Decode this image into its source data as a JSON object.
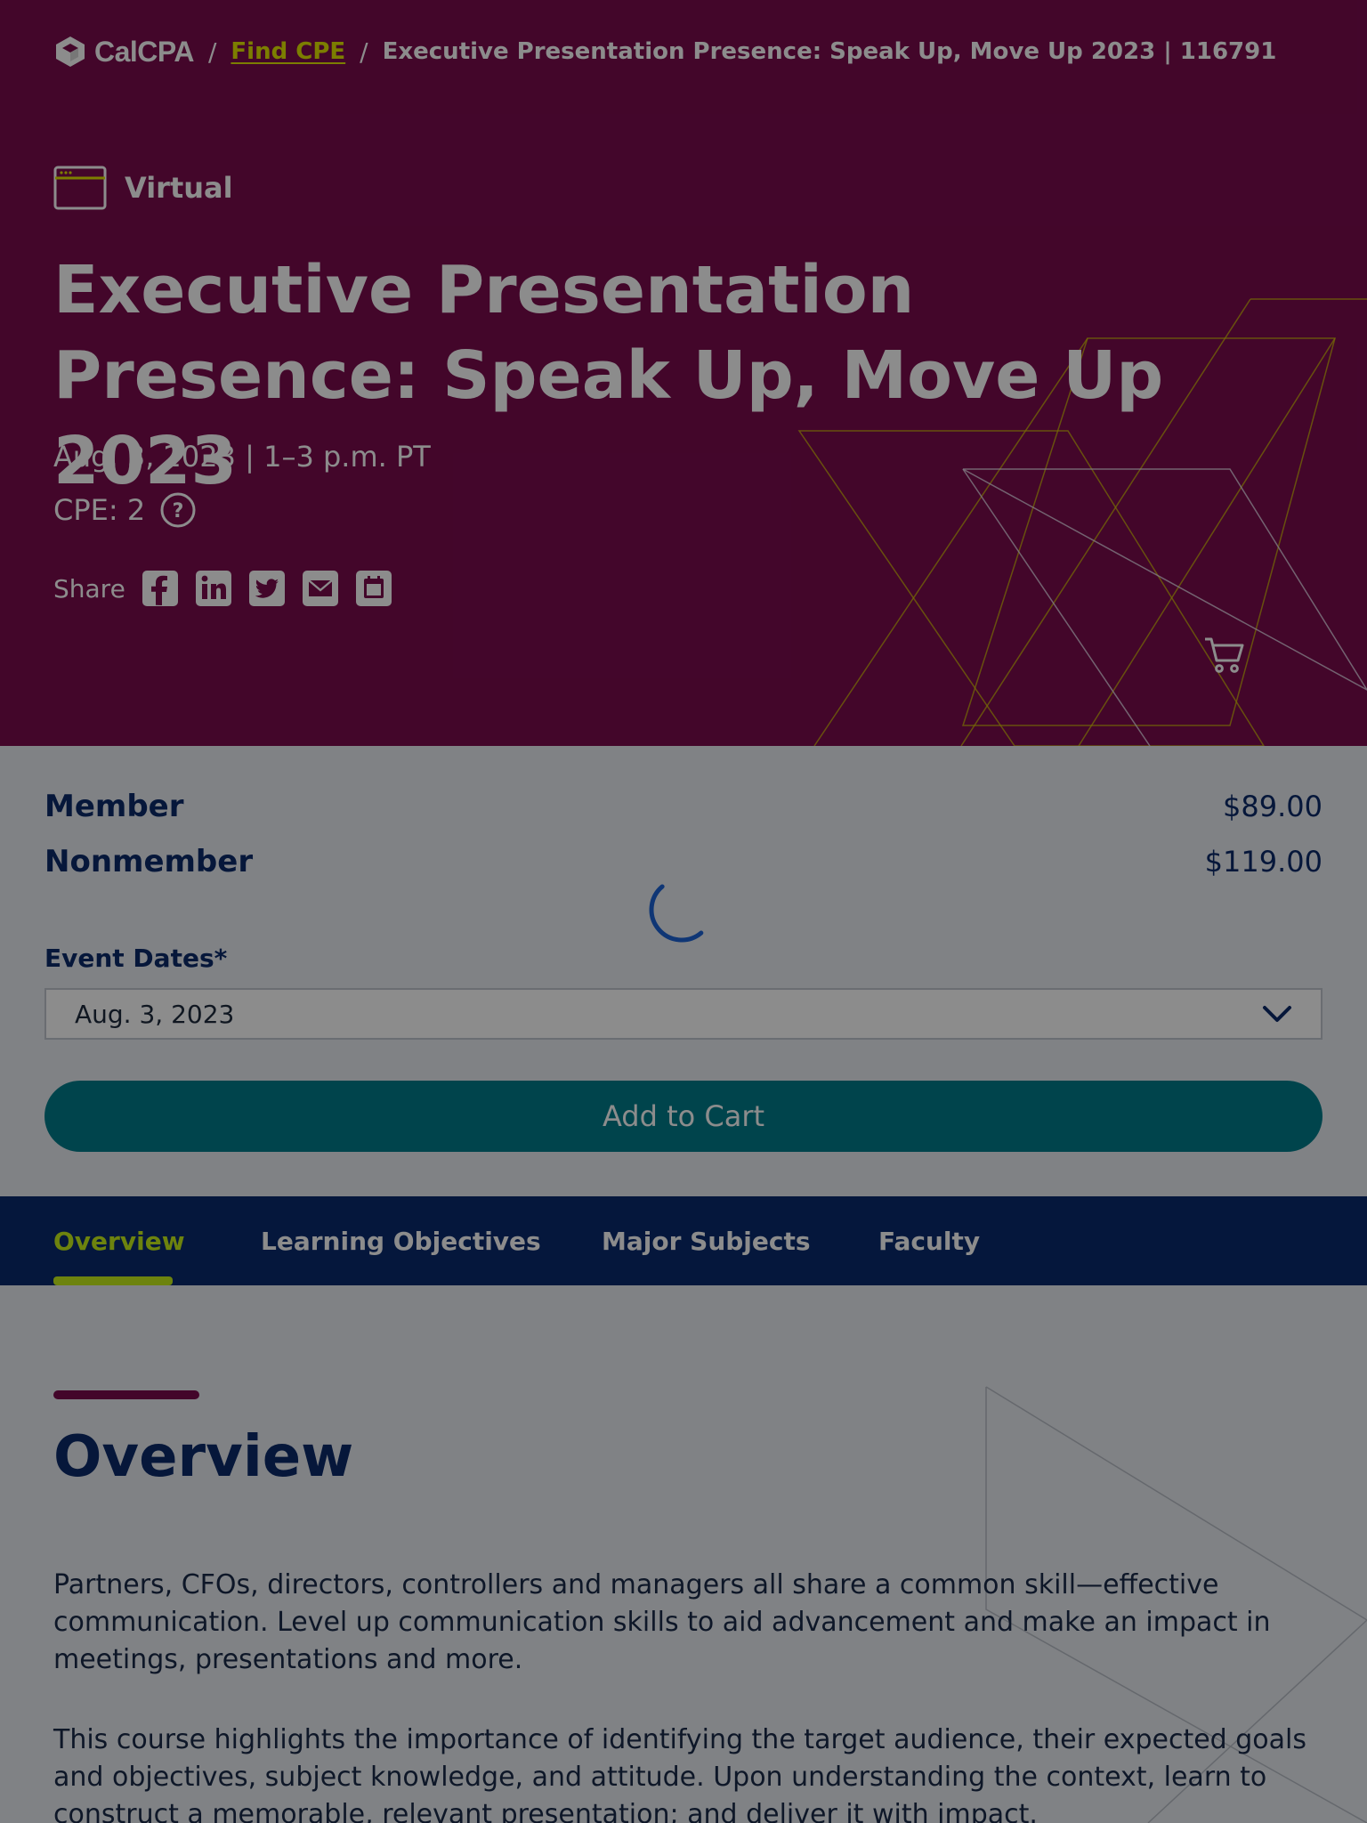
{
  "breadcrumb": {
    "brand": "CalCPA",
    "link": "Find CPE",
    "current": "Executive Presentation Presence: Speak Up, Move Up 2023 | 116791"
  },
  "hero": {
    "format": "Virtual",
    "format_icon": "browser-window-icon",
    "title": "Executive Presentation Presence: Speak Up, Move Up 2023",
    "date": "Aug. 3, 2023 | 1–3 p.m. PT",
    "cpe": "CPE: 2",
    "share_label": "Share",
    "share_icons": [
      "facebook-icon",
      "linkedin-icon",
      "twitter-icon",
      "email-icon",
      "calendar-icon"
    ]
  },
  "pricing": {
    "member_label": "Member",
    "member_price": "$89.00",
    "nonmember_label": "Nonmember",
    "nonmember_price": "$119.00"
  },
  "event_dates": {
    "label": "Event Dates*",
    "selected": "Aug. 3, 2023"
  },
  "add_to_cart": "Add to Cart",
  "tabs": [
    "Overview",
    "Learning Objectives",
    "Major Subjects",
    "Faculty"
  ],
  "active_tab": "Overview",
  "overview": {
    "title": "Overview",
    "paragraphs": [
      "Partners, CFOs, directors, controllers and managers all share a common skill—effective communication. Level up communication skills to aid advancement and make an impact in meetings, presentations and more.",
      "This course highlights the importance of identifying the target audience, their expected goals and objectives, subject knowledge, and attitude. Upon understanding the context, learn to construct a memorable, relevant presentation; and deliver it with impact."
    ]
  },
  "colors": {
    "hero_bg": "#7a0b4e",
    "accent_yellow": "#e2e600",
    "tab_active": "#c6ee1a",
    "tab_bar": "#0a2a6e",
    "button_teal": "#007c8a",
    "text_navy": "#0b2a6b"
  }
}
